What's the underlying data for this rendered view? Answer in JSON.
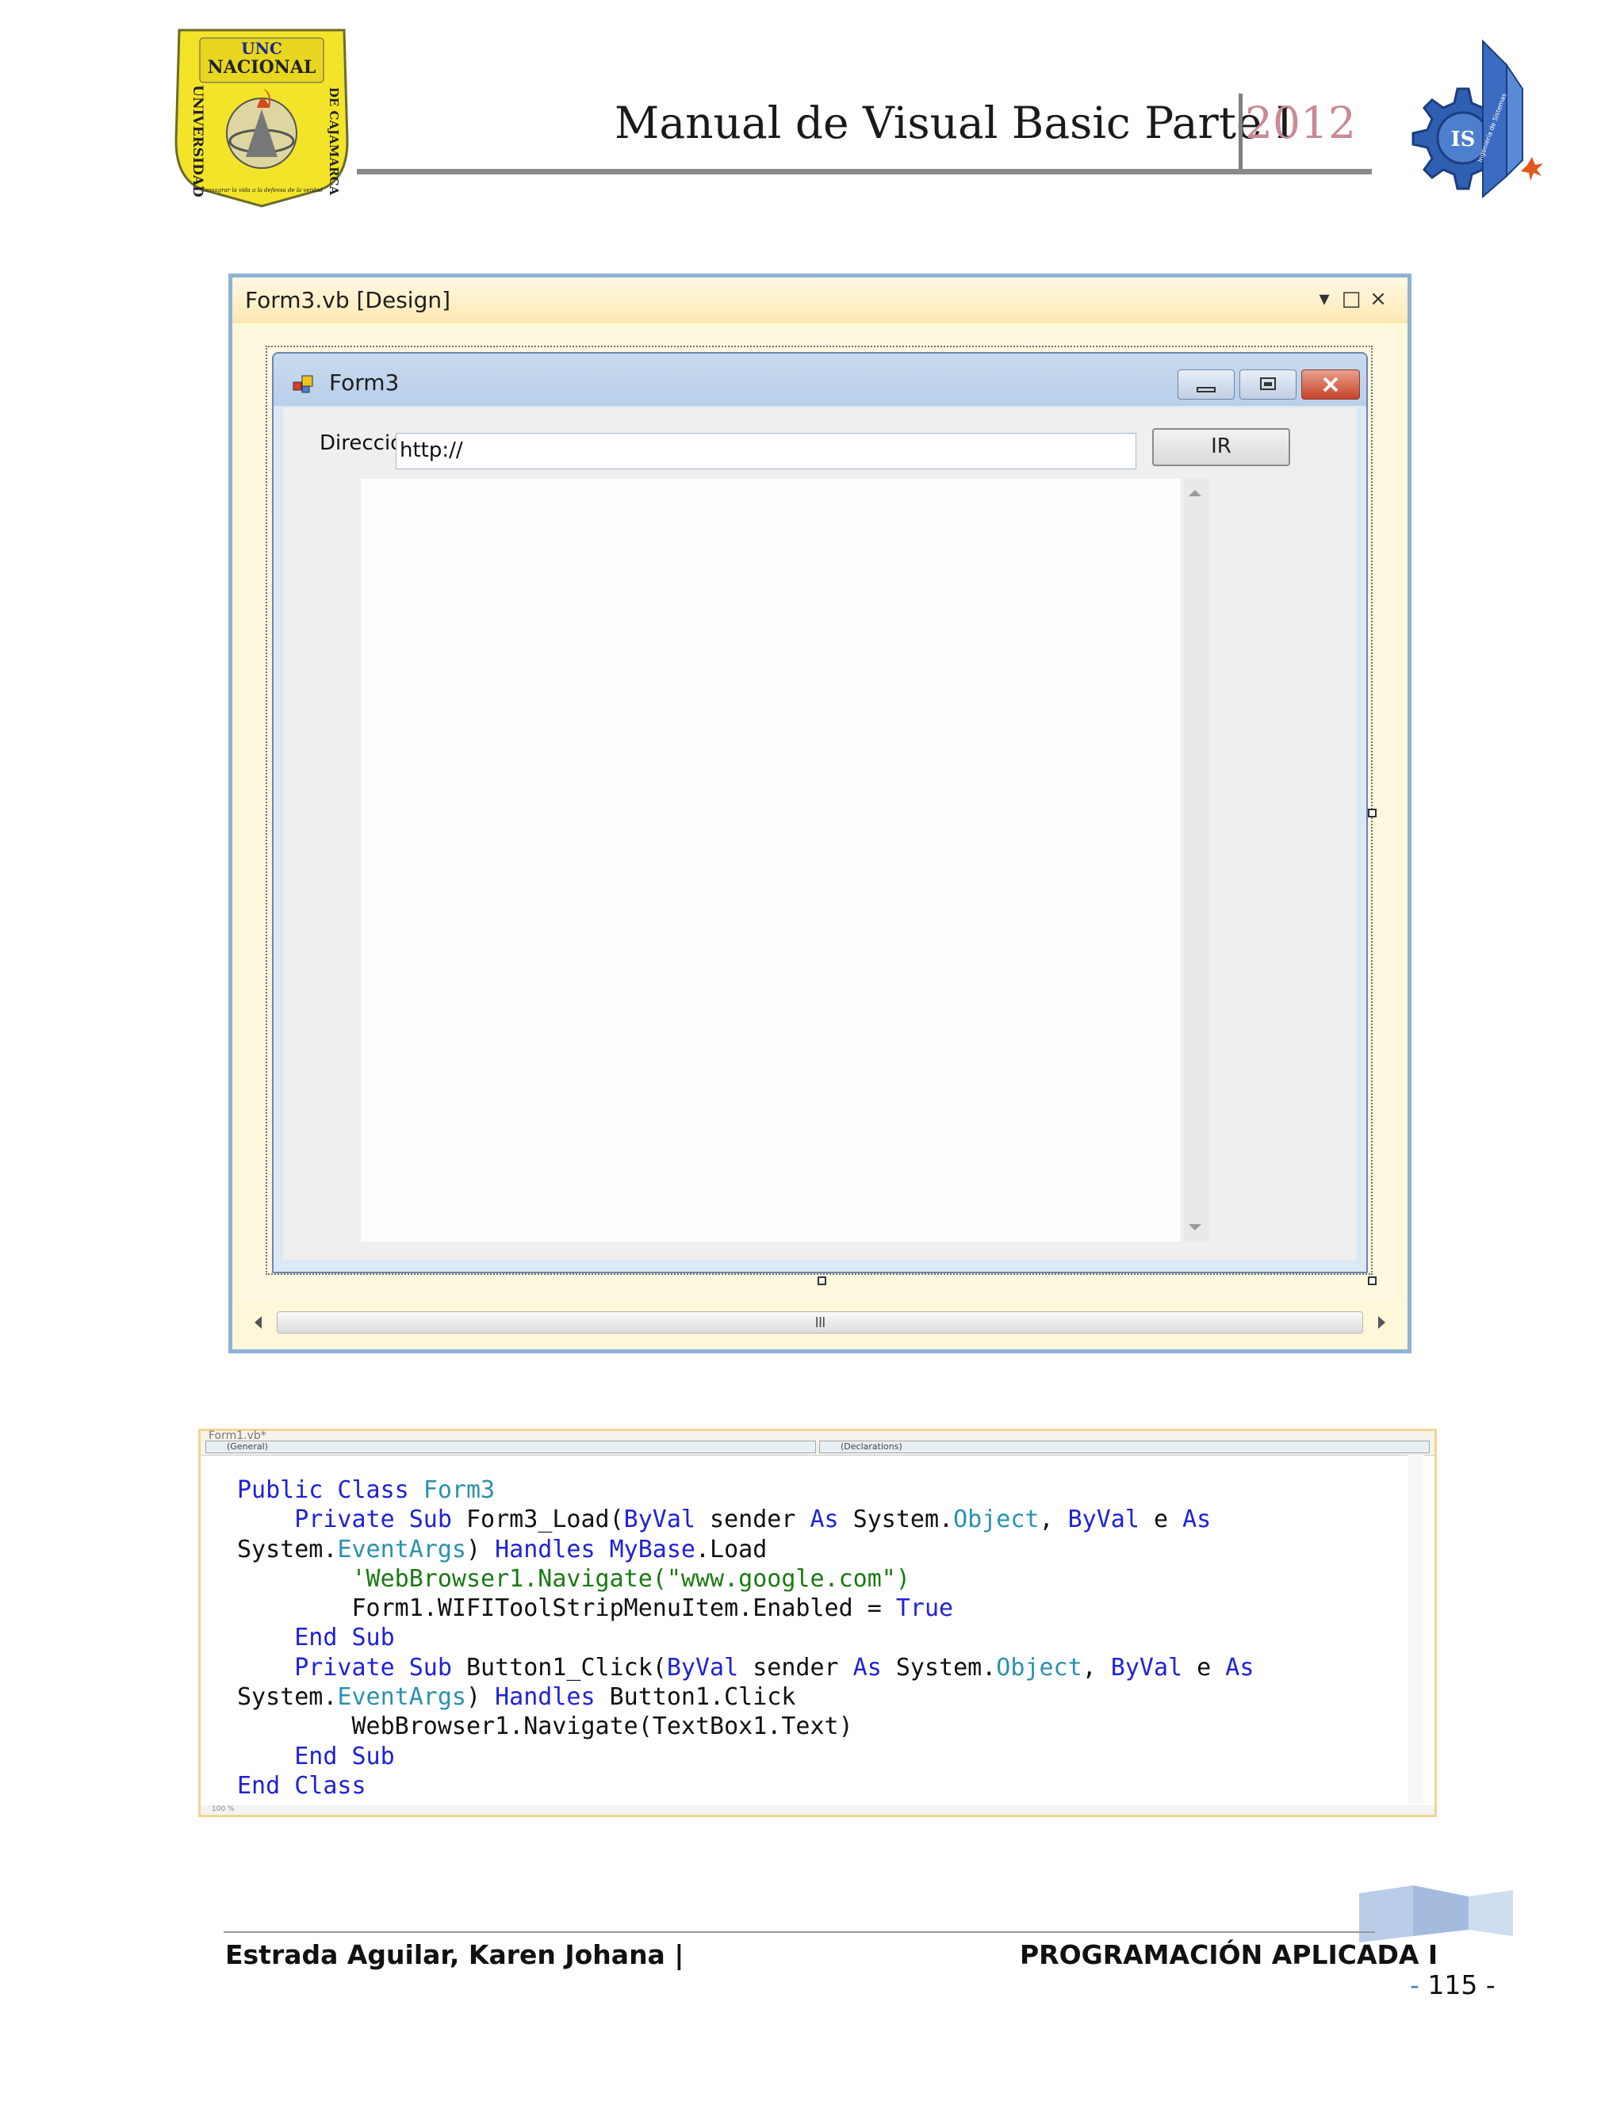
{
  "header": {
    "title": "Manual de Visual Basic Parte I",
    "year": "2012",
    "logo_left_text": [
      "UNC",
      "NACIONAL",
      "UNIVERSIDAD",
      "DE CAJAMARCA",
      "Consagrar la vida a la defensa de la verdad"
    ],
    "logo_right_text": [
      "IS",
      "Ingeniería de Sistemas"
    ]
  },
  "designer": {
    "title": "Form3.vb [Design]",
    "controls": {
      "dropdown": "▾",
      "maximize": "□",
      "close": "×"
    },
    "form": {
      "title": "Form3",
      "label_direccion": "Dirección",
      "url_value": "http://",
      "button_ir": "IR"
    },
    "hscroll_grip": "III"
  },
  "code": {
    "tab_label": "Form1.vb*",
    "combo_left": "(General)",
    "combo_right": "(Declarations)",
    "zoom": "100 %",
    "lines": [
      [
        {
          "t": "Public Class ",
          "c": "k"
        },
        {
          "t": "Form3",
          "c": "t"
        }
      ],
      [
        {
          "t": "    Private Sub ",
          "c": "k"
        },
        {
          "t": "Form3_Load(",
          "c": "n"
        },
        {
          "t": "ByVal",
          "c": "k"
        },
        {
          "t": " sender ",
          "c": "n"
        },
        {
          "t": "As",
          "c": "k"
        },
        {
          "t": " System.",
          "c": "n"
        },
        {
          "t": "Object",
          "c": "t"
        },
        {
          "t": ", ",
          "c": "n"
        },
        {
          "t": "ByVal",
          "c": "k"
        },
        {
          "t": " e ",
          "c": "n"
        },
        {
          "t": "As",
          "c": "k"
        }
      ],
      [
        {
          "t": "System.",
          "c": "n"
        },
        {
          "t": "EventArgs",
          "c": "t"
        },
        {
          "t": ") ",
          "c": "n"
        },
        {
          "t": "Handles MyBase",
          "c": "k"
        },
        {
          "t": ".Load",
          "c": "n"
        }
      ],
      [
        {
          "t": "        'WebBrowser1.Navigate(\"www.google.com\")",
          "c": "c"
        }
      ],
      [
        {
          "t": "        Form1.WIFIToolStripMenuItem.Enabled = ",
          "c": "n"
        },
        {
          "t": "True",
          "c": "k"
        }
      ],
      [
        {
          "t": "    End Sub",
          "c": "k"
        }
      ],
      [
        {
          "t": "    Private Sub ",
          "c": "k"
        },
        {
          "t": "Button1_Click(",
          "c": "n"
        },
        {
          "t": "ByVal",
          "c": "k"
        },
        {
          "t": " sender ",
          "c": "n"
        },
        {
          "t": "As",
          "c": "k"
        },
        {
          "t": " System.",
          "c": "n"
        },
        {
          "t": "Object",
          "c": "t"
        },
        {
          "t": ", ",
          "c": "n"
        },
        {
          "t": "ByVal",
          "c": "k"
        },
        {
          "t": " e ",
          "c": "n"
        },
        {
          "t": "As",
          "c": "k"
        }
      ],
      [
        {
          "t": "System.",
          "c": "n"
        },
        {
          "t": "EventArgs",
          "c": "t"
        },
        {
          "t": ") ",
          "c": "n"
        },
        {
          "t": "Handles",
          "c": "k"
        },
        {
          "t": " Button1.Click",
          "c": "n"
        }
      ],
      [
        {
          "t": "        WebBrowser1.Navigate(TextBox1.Text)",
          "c": "n"
        }
      ],
      [
        {
          "t": "    End Sub",
          "c": "k"
        }
      ],
      [
        {
          "t": "End Class",
          "c": "k"
        }
      ]
    ]
  },
  "footer": {
    "author": "Estrada Aguilar, Karen Johana |",
    "course": "PROGRAMACIÓN APLICADA I",
    "page_number": "115"
  },
  "colors": {
    "keyword": "#1f22d6",
    "type": "#2b91af",
    "comment": "#1a7a12",
    "year": "#c98a95",
    "designer_border": "#8fb2d6"
  }
}
